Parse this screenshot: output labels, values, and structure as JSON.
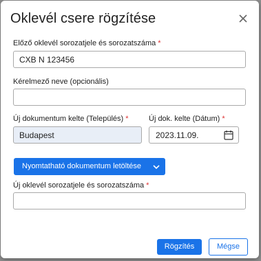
{
  "dialog": {
    "title": "Oklevél csere rögzítése",
    "close_icon": "close-icon"
  },
  "fields": {
    "previous_serial": {
      "label": "Előző oklevél sorozatjele és sorozatszáma",
      "required_mark": "*",
      "value": "CXB N 123456"
    },
    "applicant_name": {
      "label": "Kérelmező neve (opcionális)",
      "value": ""
    },
    "new_doc_place": {
      "label": "Új dokumentum kelte (Település)",
      "required_mark": "*",
      "value": "Budapest"
    },
    "new_doc_date": {
      "label": "Új dok. kelte (Dátum)",
      "required_mark": "*",
      "value": "2023.11.09.",
      "icon": "calendar-icon"
    },
    "new_serial": {
      "label": "Új oklevél sorozatjele és sorozatszáma",
      "required_mark": "*",
      "value": ""
    }
  },
  "actions": {
    "download_label": "Nyomtatható dokumentum letöltése",
    "download_dropdown_icon": "chevron-down-icon",
    "save_label": "Rögzítés",
    "cancel_label": "Mégse"
  },
  "colors": {
    "primary": "#1a73e8",
    "required": "#dd3333",
    "filled_input_bg": "#e8eef7"
  }
}
